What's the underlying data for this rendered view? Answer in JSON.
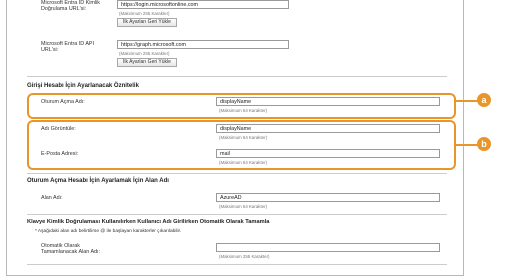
{
  "entra_id_auth_url": {
    "label": "Microsoft Entra ID Kimlik Doğrulama URL'si:",
    "value": "https://login.microsoftonline.com",
    "hint": "(Maksimum 255 Karakter)",
    "reset_label": "İlk Ayarları Geri Yükle"
  },
  "entra_id_api_url": {
    "label": "Microsoft Entra ID API URL'si:",
    "value": "https://graph.microsoft.com",
    "hint": "(Maksimum 255 Karakter)",
    "reset_label": "İlk Ayarları Geri Yükle"
  },
  "login_attributes": {
    "title": "Girişi Hesabı İçin Ayarlanacak Öznitelik",
    "login_name": {
      "label": "Oturum Açma Adı:",
      "value": "displayName",
      "hint": "(Maksimum 64 Karakter)"
    },
    "display_name": {
      "label": "Adı Görüntüle:",
      "value": "displayName",
      "hint": "(Maksimum 64 Karakter)"
    },
    "email": {
      "label": "E-Posta Adresi:",
      "value": "mail",
      "hint": "(Maksimum 64 Karakter)"
    }
  },
  "domain_section": {
    "title": "Oturum Açma Hesabı İçin Ayarlamak İçin Alan Adı",
    "domain_name": {
      "label": "Alan Adı:",
      "value": "AzureAD",
      "hint": "(Maksimum 64 Karakter)"
    }
  },
  "keyboard_section": {
    "title": "Klavye Kimlik Doğrulaması Kullanılırken Kullanıcı Adı Girilirken Otomatik Olarak Tamamla",
    "note": "* Aşağıdaki alan adı belirtilirse @ ile başlayan karakterler çıkarılabilir.",
    "auto_complete": {
      "label": "Otomatik Olarak Tamamlanacak Alan Adı:",
      "value": "",
      "hint": "(Maksimum 255 Karakter)"
    }
  },
  "callouts": {
    "a": "a",
    "b": "b"
  },
  "colors": {
    "callout": "#e8962a"
  }
}
